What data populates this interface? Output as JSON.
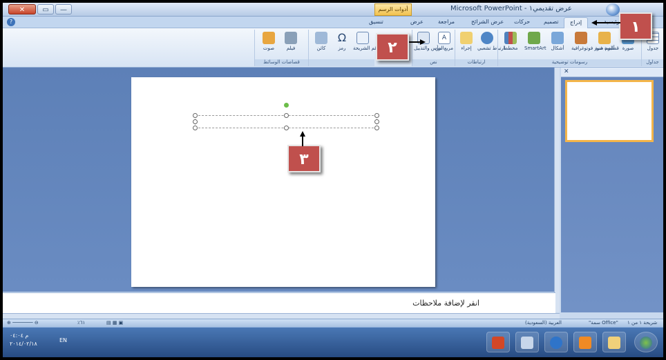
{
  "window": {
    "title": "Microsoft PowerPoint - عرض تقديمي١",
    "contextual_tab": "أدوات الرسم",
    "contextual_sub": "تنسيق",
    "close_label": "✕",
    "max_label": "▭",
    "min_label": "—"
  },
  "tabs": [
    {
      "label": "الرئيسية"
    },
    {
      "label": "إدراج"
    },
    {
      "label": "تصميم"
    },
    {
      "label": "حركات"
    },
    {
      "label": "عرض الشرائح"
    },
    {
      "label": "مراجعة"
    },
    {
      "label": "عرض"
    },
    {
      "label": "تنسيق"
    }
  ],
  "ribbon": {
    "groups": [
      {
        "name": "جداول",
        "buttons": [
          "جدول"
        ]
      },
      {
        "name": "رسومات توضيحية",
        "buttons": [
          "صورة",
          "قصاصة فنية",
          "ألبوم صور فوتوغرافية",
          "أشكال",
          "SmartArt",
          "مخطط"
        ]
      },
      {
        "name": "ارتباطات",
        "buttons": [
          "ارتباط تشعبي",
          "إجراء"
        ]
      },
      {
        "name": "نص",
        "buttons": [
          "مربع نص",
          "الرأس والتذييل"
        ]
      },
      {
        "name": "",
        "buttons": [
          "رقم الشريحة",
          "رمز",
          "كائن"
        ]
      },
      {
        "name": "قصاصات الوسائط",
        "buttons": [
          "فيلم",
          "صوت"
        ]
      }
    ]
  },
  "notes_placeholder": "انقر لإضافة ملاحظات",
  "status": {
    "slide_info": "شريحة ١ من ١",
    "theme": "\"سمة Office\"",
    "language": "العربية (السعودية)",
    "zoom": "٪٦١"
  },
  "taskbar": {
    "time": "م ٠٤:٠٤",
    "date": "٢٠١٤/٠٢/١٨",
    "lang": "EN"
  },
  "callouts": {
    "one": "١",
    "two": "٢",
    "three": "٣"
  },
  "colors": {
    "callout": "#c0504d",
    "workspace": "#5d80b7",
    "selection_thumb": "#f4b54a",
    "rotate_handle": "#6cbd4a"
  }
}
